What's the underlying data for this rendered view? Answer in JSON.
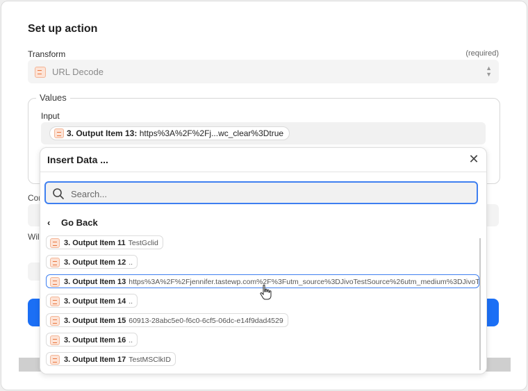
{
  "page": {
    "title": "Set up action",
    "transform_label": "Transform",
    "required_label": "(required)",
    "transform_value": "URL Decode",
    "values_legend": "Values",
    "input_label": "Input",
    "input_pill_name": "3. Output Item 13:",
    "input_pill_value": "https%3A%2F%2Fj...wc_clear%3Dtrue",
    "bg_label_con": "Con",
    "bg_label_wil": "Wil"
  },
  "insert_data": {
    "title": "Insert Data ...",
    "search_placeholder": "Search...",
    "go_back": "Go Back",
    "items": [
      {
        "name": "3. Output Item 11",
        "value": "TestGclid"
      },
      {
        "name": "3. Output Item 12",
        "value": ".."
      },
      {
        "name": "3. Output Item 13",
        "value": "https%3A%2F%2Fjennifer.tastewp.com%2F%3Futm_source%3DJivoTestSource%26utm_medium%3DJivoTe"
      },
      {
        "name": "3. Output Item 14",
        "value": ".."
      },
      {
        "name": "3. Output Item 15",
        "value": "60913-28abc5e0-f6c0-6cf5-06dc-e14f9dad4529"
      },
      {
        "name": "3. Output Item 16",
        "value": ".."
      },
      {
        "name": "3. Output Item 17",
        "value": "TestMSClkID"
      }
    ]
  },
  "colors": {
    "accent": "#1b6ff5",
    "focus": "#3e7ff0",
    "app_icon": "#e8743b"
  },
  "icons": [
    "url-decode-app-icon",
    "select-arrows-icon",
    "close-icon",
    "search-icon",
    "chevron-left-icon",
    "hand-cursor-icon"
  ]
}
